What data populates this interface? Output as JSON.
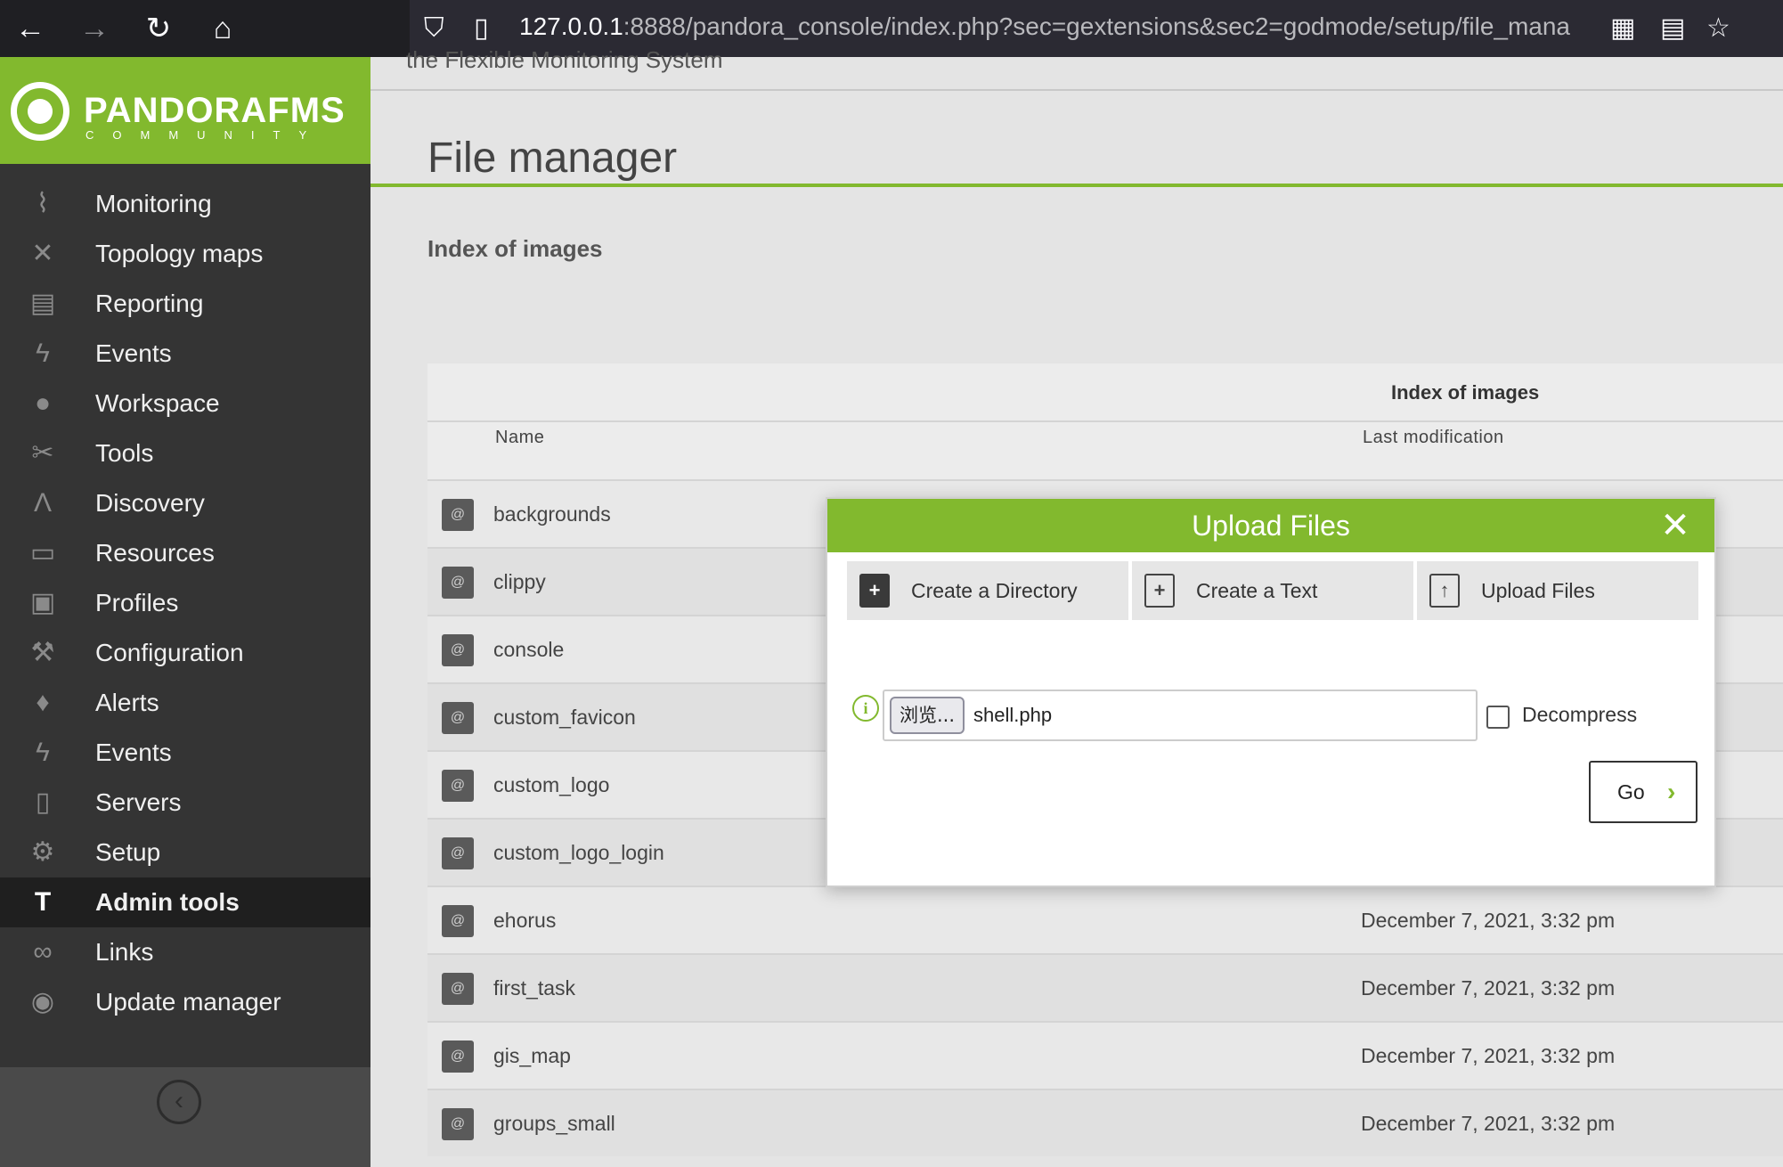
{
  "browser": {
    "url_host": "127.0.0.1",
    "url_rest": ":8888/pandora_console/index.php?sec=gextensions&sec2=godmode/setup/file_mana"
  },
  "brand": {
    "name": "PANDORAFMS",
    "edition": "COMMUNITY",
    "accent_color": "#82b92e"
  },
  "sidebar": {
    "items": [
      {
        "label": "Monitoring",
        "icon": "heartbeat-icon",
        "glyph": "⌇"
      },
      {
        "label": "Topology maps",
        "icon": "topology-icon",
        "glyph": "✕"
      },
      {
        "label": "Reporting",
        "icon": "reporting-icon",
        "glyph": "▤"
      },
      {
        "label": "Events",
        "icon": "lightning-icon",
        "glyph": "ϟ"
      },
      {
        "label": "Workspace",
        "icon": "user-icon",
        "glyph": "●"
      },
      {
        "label": "Tools",
        "icon": "tools-icon",
        "glyph": "✂"
      },
      {
        "label": "Discovery",
        "icon": "discovery-icon",
        "glyph": "Λ"
      },
      {
        "label": "Resources",
        "icon": "resources-icon",
        "glyph": "▭"
      },
      {
        "label": "Profiles",
        "icon": "profile-icon",
        "glyph": "▣"
      },
      {
        "label": "Configuration",
        "icon": "wrench-icon",
        "glyph": "⚒"
      },
      {
        "label": "Alerts",
        "icon": "bell-icon",
        "glyph": "♦"
      },
      {
        "label": "Events",
        "icon": "event-bolt-icon",
        "glyph": "ϟ"
      },
      {
        "label": "Servers",
        "icon": "server-icon",
        "glyph": "▯"
      },
      {
        "label": "Setup",
        "icon": "gear-icon",
        "glyph": "⚙"
      },
      {
        "label": "Admin tools",
        "icon": "admin-tools-icon",
        "glyph": "T"
      },
      {
        "label": "Links",
        "icon": "link-icon",
        "glyph": "∞"
      },
      {
        "label": "Update manager",
        "icon": "update-icon",
        "glyph": "◉"
      }
    ],
    "active_index": 14
  },
  "header": {
    "top_text": "the Flexible Monitoring System",
    "title": "File manager",
    "subtitle": "Index of images"
  },
  "table": {
    "caption": "Index of images",
    "columns": {
      "name": "Name",
      "modified": "Last modification"
    },
    "rows": [
      {
        "name": "backgrounds",
        "modified": ""
      },
      {
        "name": "clippy",
        "modified": ""
      },
      {
        "name": "console",
        "modified": ""
      },
      {
        "name": "custom_favicon",
        "modified": ""
      },
      {
        "name": "custom_logo",
        "modified": ""
      },
      {
        "name": "custom_logo_login",
        "modified": ""
      },
      {
        "name": "ehorus",
        "modified": "December 7, 2021, 3:32 pm"
      },
      {
        "name": "first_task",
        "modified": "December 7, 2021, 3:32 pm"
      },
      {
        "name": "gis_map",
        "modified": "December 7, 2021, 3:32 pm"
      },
      {
        "name": "groups_small",
        "modified": "December 7, 2021, 3:32 pm"
      }
    ]
  },
  "modal": {
    "title": "Upload Files",
    "tabs": [
      {
        "label": "Create a Directory",
        "icon": "create-directory-icon"
      },
      {
        "label": "Create a Text",
        "icon": "create-text-icon"
      },
      {
        "label": "Upload Files",
        "icon": "upload-files-icon"
      }
    ],
    "browse_label": "浏览...",
    "file_value": "shell.php",
    "decompress_label": "Decompress",
    "decompress_checked": false,
    "go_label": "Go"
  }
}
